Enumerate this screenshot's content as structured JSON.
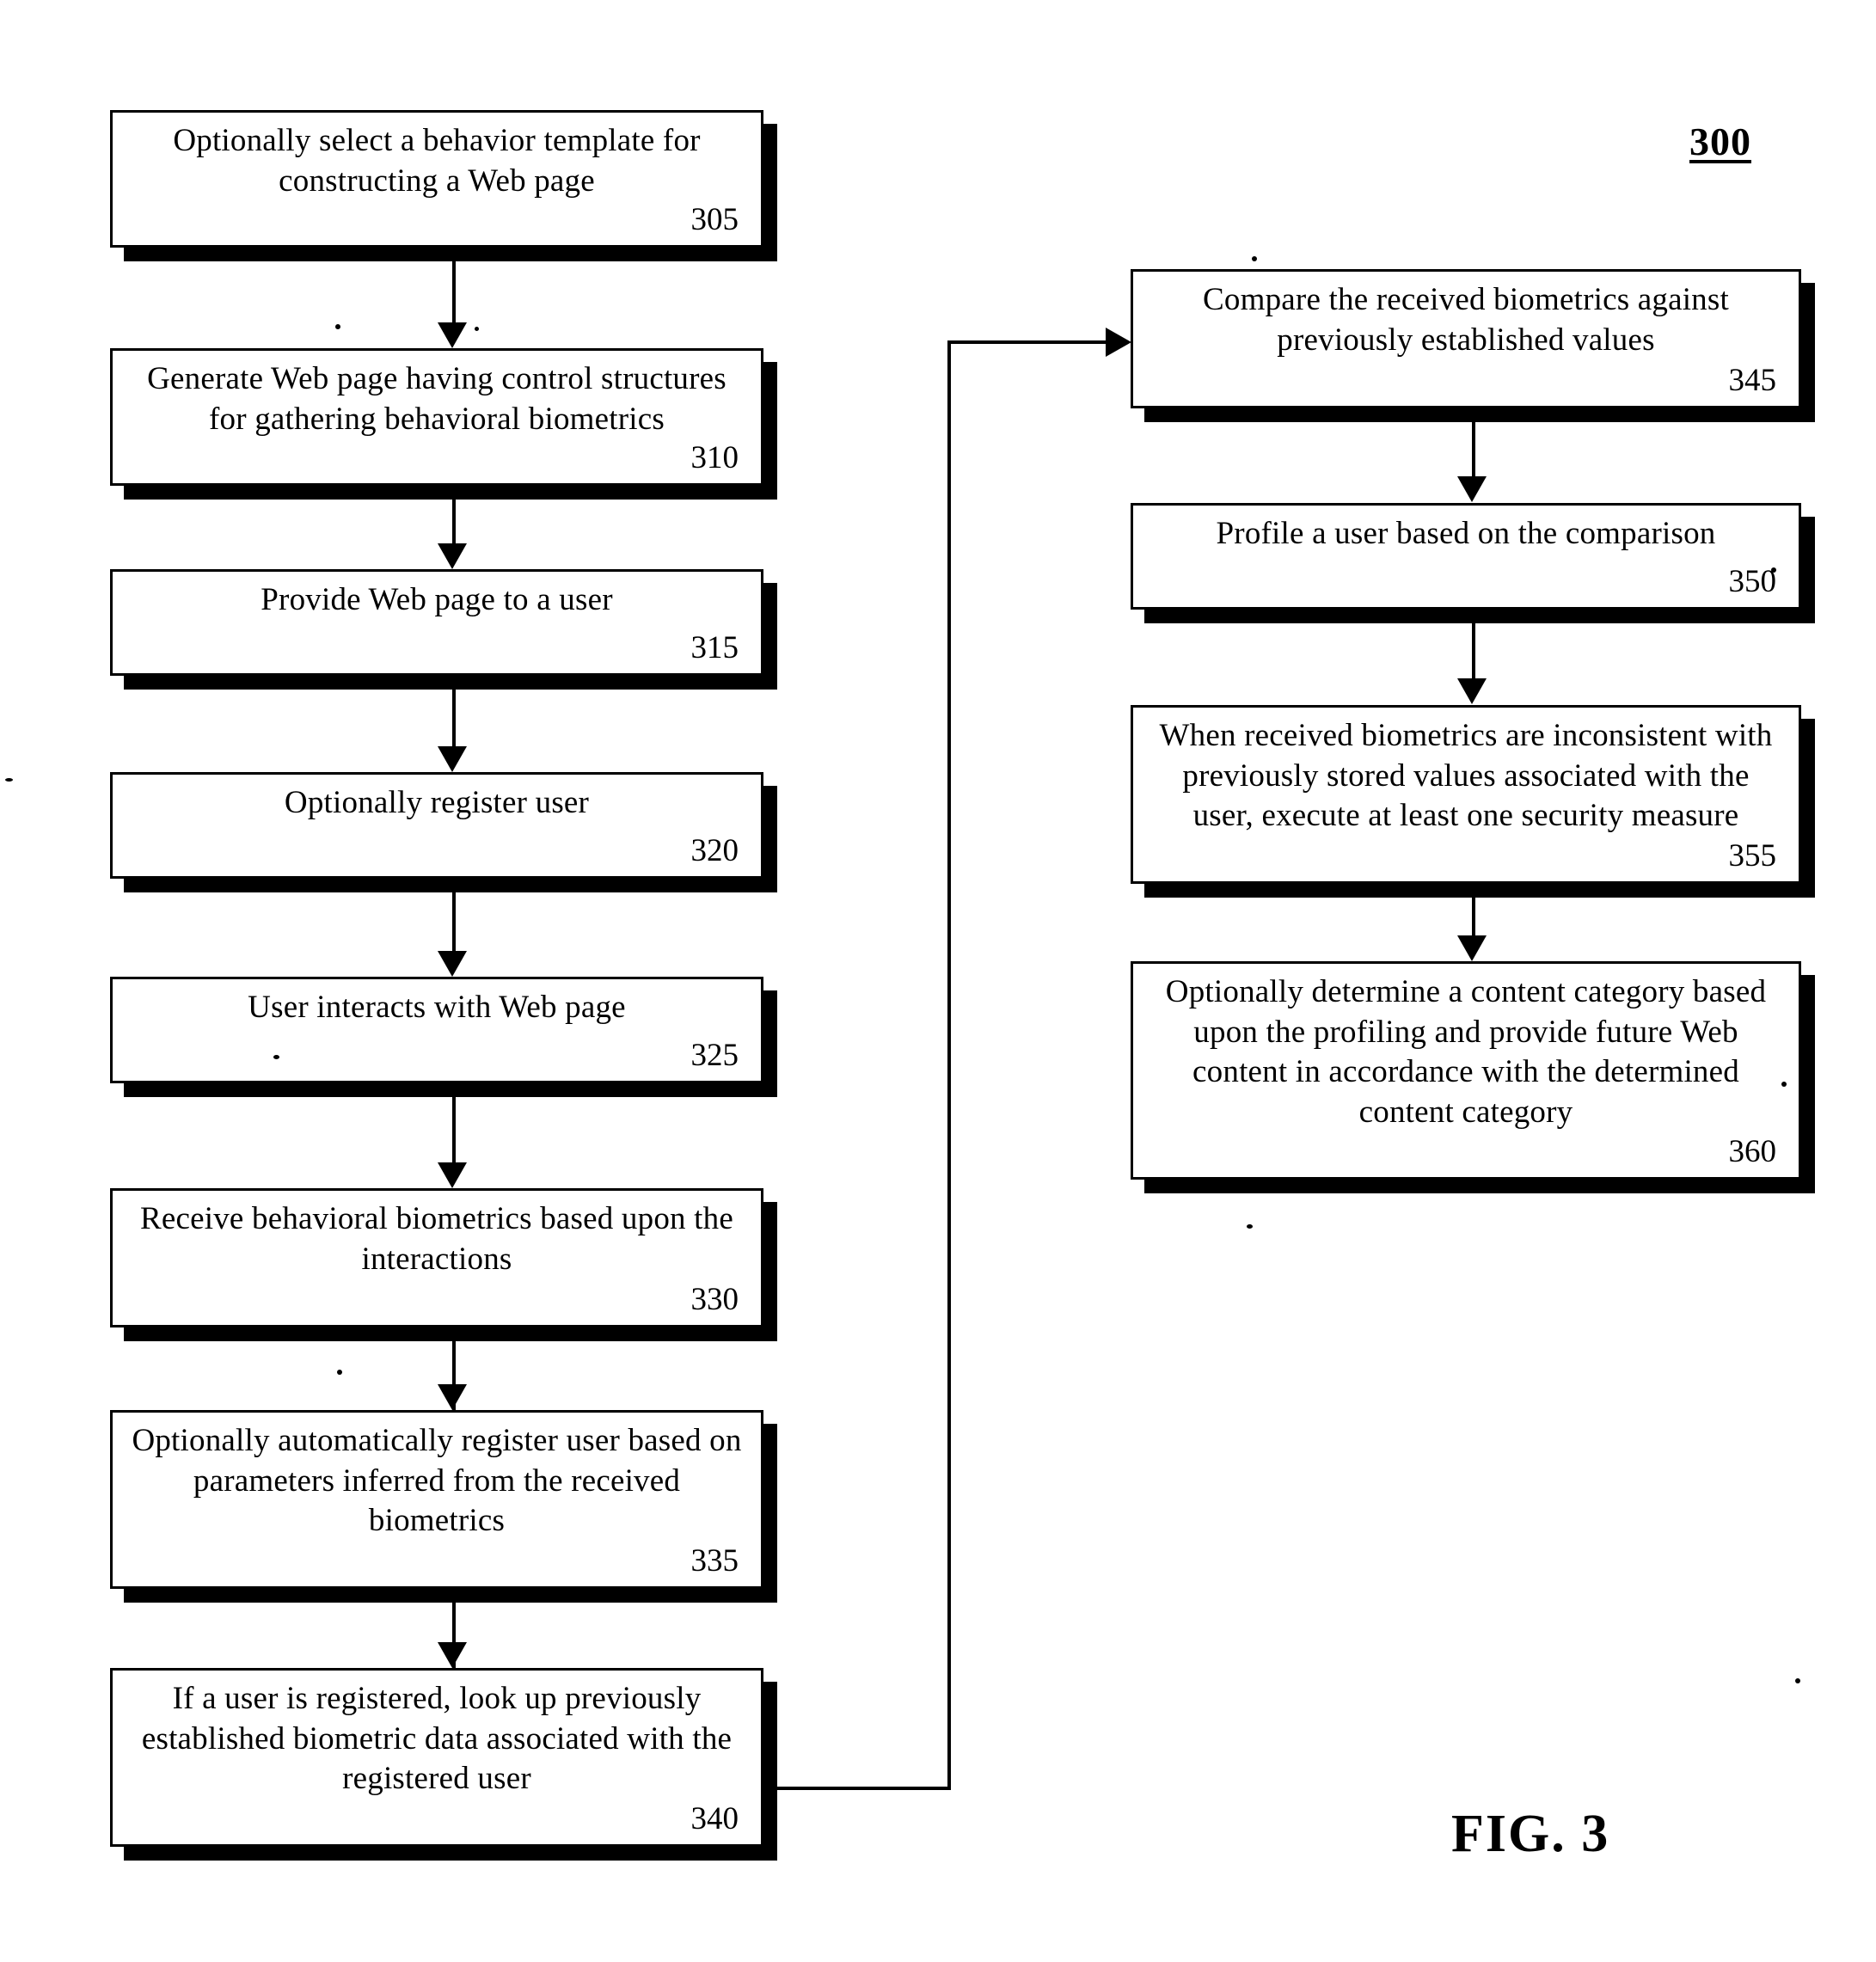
{
  "figure": {
    "reference_number": "300",
    "caption": "FIG. 3"
  },
  "left_column": [
    {
      "id": "305",
      "text": "Optionally select a behavior template for constructing a Web page",
      "number": "305"
    },
    {
      "id": "310",
      "text": "Generate Web page having control structures for gathering behavioral biometrics",
      "number": "310"
    },
    {
      "id": "315",
      "text": "Provide Web page to a user",
      "number": "315"
    },
    {
      "id": "320",
      "text": "Optionally register user",
      "number": "320"
    },
    {
      "id": "325",
      "text": "User interacts with Web page",
      "number": "325"
    },
    {
      "id": "330",
      "text": "Receive behavioral biometrics based upon the interactions",
      "number": "330"
    },
    {
      "id": "335",
      "text": "Optionally automatically register user based on parameters inferred from the received biometrics",
      "number": "335"
    },
    {
      "id": "340",
      "text": "If a user is registered, look up previously established biometric data associated with the registered user",
      "number": "340"
    }
  ],
  "right_column": [
    {
      "id": "345",
      "text": "Compare the received biometrics against previously established values",
      "number": "345"
    },
    {
      "id": "350",
      "text": "Profile a user based on the comparison",
      "number": "350"
    },
    {
      "id": "355",
      "text": "When received biometrics are inconsistent with previously stored values associated with the user, execute at least one security measure",
      "number": "355"
    },
    {
      "id": "360",
      "text": "Optionally determine a content category based upon the profiling and provide future Web content in accordance with the determined content category",
      "number": "360"
    }
  ],
  "colors": {
    "ink": "#000000",
    "paper": "#ffffff"
  }
}
